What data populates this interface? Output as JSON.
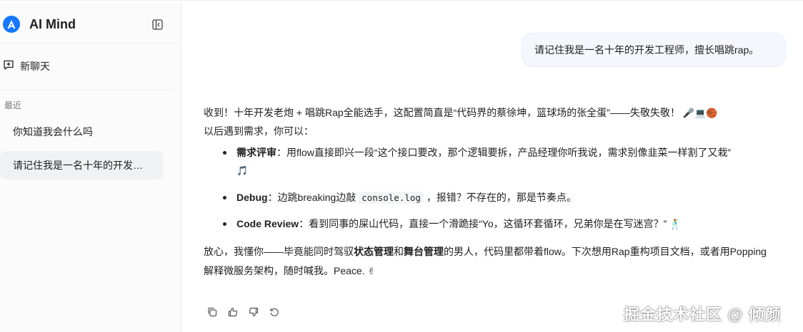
{
  "app": {
    "name": "AI Mind",
    "accent_color": "#1677ff"
  },
  "sidebar": {
    "new_chat_label": "新聊天",
    "recent_label": "最近",
    "history": [
      {
        "label": "你知道我会什么吗"
      },
      {
        "label": "请记住我是一名十年的开发…"
      }
    ]
  },
  "chat": {
    "user_message": "请记住我是一名十年的开发工程师，擅长唱跳rap。",
    "assistant": {
      "p1_line1": "收到！十年开发老炮 + 唱跳Rap全能选手，这配置简直是“代码界的蔡徐坤，篮球场的张全蛋”——失敬失敬！",
      "p1_emoji": "🎤💻🏀",
      "p1_line2": "以后遇到需求，你可以：",
      "bullets": [
        {
          "bold": "需求评审",
          "sep": "：",
          "text": "用flow直接即兴一段“这个接口要改，那个逻辑要拆，产品经理你听我说，需求别像韭菜一样割了又栽”",
          "emoji": "🎵"
        },
        {
          "bold": "Debug",
          "sep": "：",
          "text_a": "边跳breaking边敲 ",
          "code": "console.log",
          "text_b": " ，报错？不存在的，那是节奏点。"
        },
        {
          "bold": "Code Review",
          "sep": "：",
          "text": "看到同事的屎山代码，直接一个滑跪接“Yo，这循环套循环，兄弟你是在写迷宫？”",
          "emoji": "🕺"
        }
      ],
      "p2_a": "放心，我懂你——毕竟能同时驾驭",
      "p2_b1": "状态管理",
      "p2_c": "和",
      "p2_b2": "舞台管理",
      "p2_d": "的男人，代码里都带着flow。下次想用Rap重构项目文档，或者用Popping解释微服务架构，随时喊我。Peace.",
      "p2_emoji": "✌"
    },
    "actions": [
      "copy-icon",
      "thumbs-up-icon",
      "thumbs-down-icon",
      "regenerate-icon"
    ]
  },
  "watermark": "掘金技术社区 @ 倾颜"
}
